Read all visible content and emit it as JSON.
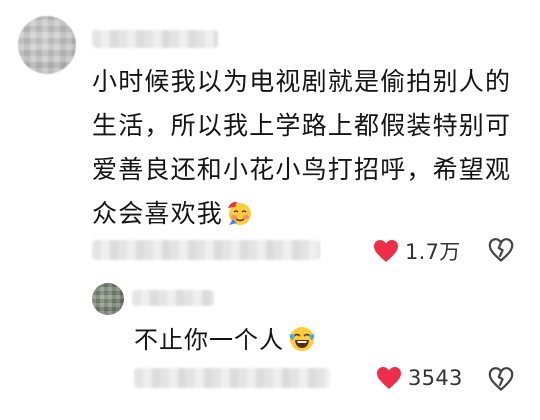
{
  "main_comment": {
    "text": "小时候我以为电视剧就是偷拍别人的生活，所以我上学路上都假装特别可爱善良还和小花小鸟打招呼，希望观众会喜欢我",
    "emoji": "shy-face-emoji",
    "likes": "1.7万"
  },
  "reply": {
    "text": "不止你一个人",
    "emoji": "laughing-crying-emoji",
    "likes": "3543"
  },
  "colors": {
    "like_heart": "#f02d49",
    "text": "#141414",
    "icon_gray": "#444444"
  },
  "icons": {
    "like": "heart-icon",
    "dislike": "broken-heart-outline-icon"
  }
}
